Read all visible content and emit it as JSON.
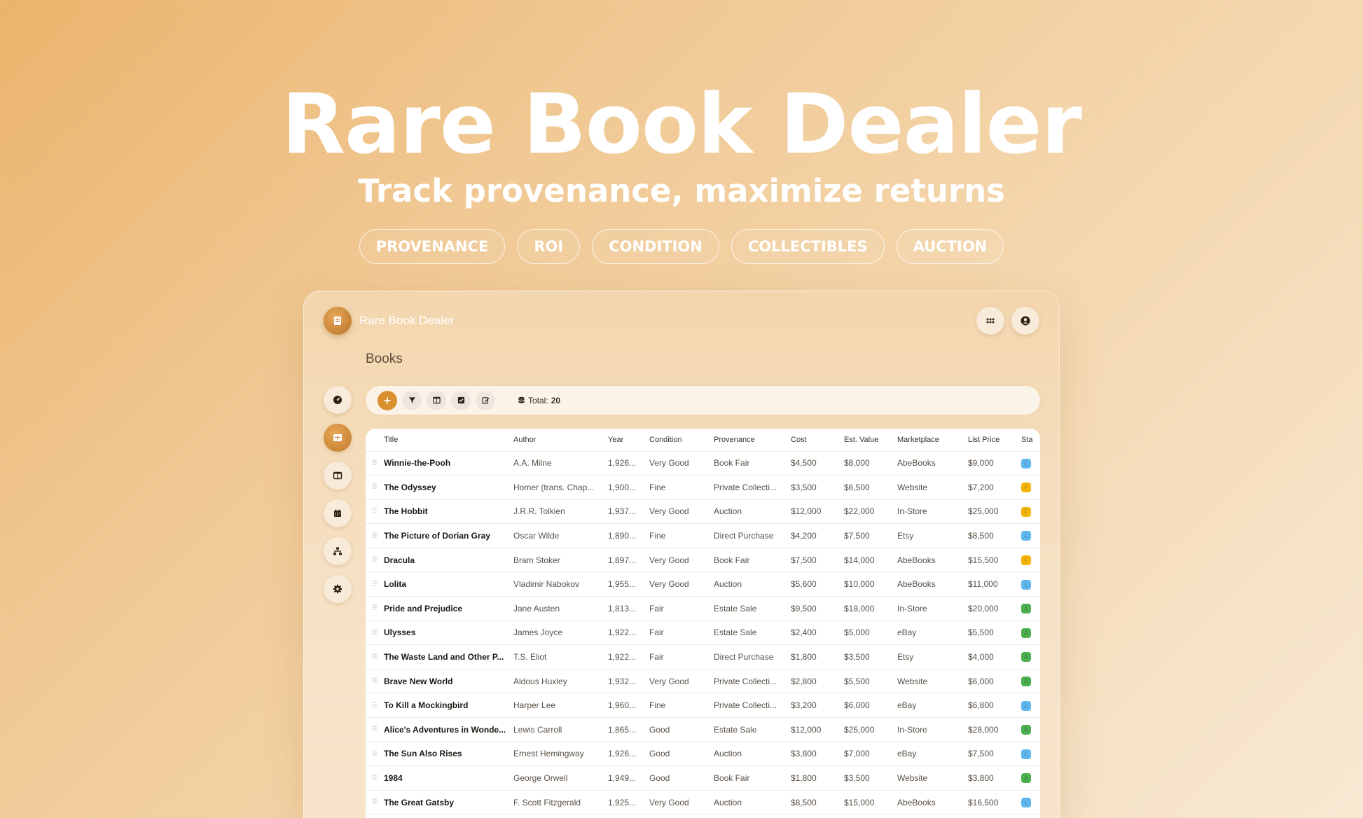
{
  "hero": {
    "title": "Rare Book Dealer",
    "subtitle": "Track provenance, maximize returns",
    "tags": [
      "PROVENANCE",
      "ROI",
      "CONDITION",
      "COLLECTIBLES",
      "AUCTION"
    ]
  },
  "app": {
    "name": "Rare Book Dealer",
    "page_title": "Books",
    "total_label": "Total:",
    "total_value": "20"
  },
  "icons": {
    "logo": "book-icon",
    "top": [
      "grid-icon",
      "user-circle-icon"
    ],
    "sidebar": [
      "dashboard-icon",
      "table-icon",
      "columns-icon",
      "calendar-icon",
      "hierarchy-icon",
      "gear-icon"
    ],
    "toolbar": [
      "plus-icon",
      "filter-icon",
      "columns-icon",
      "checkbox-icon",
      "edit-icon",
      "database-icon"
    ]
  },
  "colors": {
    "accent": "#d9902f",
    "status_blue": "#5eb6ec",
    "status_yellow": "#f4b400",
    "status_green": "#4caf50"
  },
  "table": {
    "columns": [
      "Title",
      "Author",
      "Year",
      "Condition",
      "Provenance",
      "Cost",
      "Est. Value",
      "Marketplace",
      "List Price",
      "Sta"
    ],
    "rows": [
      {
        "title": "Winnie-the-Pooh",
        "author": "A.A. Milne",
        "year": "1,926...",
        "condition": "Very Good",
        "provenance": "Book Fair",
        "cost": "$4,500",
        "value": "$8,000",
        "market": "AbeBooks",
        "price": "$9,000",
        "status": "L",
        "status_color": "#5eb6ec"
      },
      {
        "title": "The Odyssey",
        "author": "Homer (trans. Chap...",
        "year": "1,900...",
        "condition": "Fine",
        "provenance": "Private Collecti...",
        "cost": "$3,500",
        "value": "$6,500",
        "market": "Website",
        "price": "$7,200",
        "status": "F",
        "status_color": "#f4b400"
      },
      {
        "title": "The Hobbit",
        "author": "J.R.R. Tolkien",
        "year": "1,937...",
        "condition": "Very Good",
        "provenance": "Auction",
        "cost": "$12,000",
        "value": "$22,000",
        "market": "In-Store",
        "price": "$25,000",
        "status": "F",
        "status_color": "#f4b400"
      },
      {
        "title": "The Picture of Dorian Gray",
        "author": "Oscar Wilde",
        "year": "1,890...",
        "condition": "Fine",
        "provenance": "Direct Purchase",
        "cost": "$4,200",
        "value": "$7,500",
        "market": "Etsy",
        "price": "$8,500",
        "status": "L",
        "status_color": "#5eb6ec"
      },
      {
        "title": "Dracula",
        "author": "Bram Stoker",
        "year": "1,897...",
        "condition": "Very Good",
        "provenance": "Book Fair",
        "cost": "$7,500",
        "value": "$14,000",
        "market": "AbeBooks",
        "price": "$15,500",
        "status": "F",
        "status_color": "#f4b400"
      },
      {
        "title": "Lolita",
        "author": "Vladimir Nabokov",
        "year": "1,955...",
        "condition": "Very Good",
        "provenance": "Auction",
        "cost": "$5,600",
        "value": "$10,000",
        "market": "AbeBooks",
        "price": "$11,000",
        "status": "L",
        "status_color": "#5eb6ec"
      },
      {
        "title": "Pride and Prejudice",
        "author": "Jane Austen",
        "year": "1,813...",
        "condition": "Fair",
        "provenance": "Estate Sale",
        "cost": "$9,500",
        "value": "$18,000",
        "market": "In-Store",
        "price": "$20,000",
        "status": "A",
        "status_color": "#4caf50"
      },
      {
        "title": "Ulysses",
        "author": "James Joyce",
        "year": "1,922...",
        "condition": "Fair",
        "provenance": "Estate Sale",
        "cost": "$2,400",
        "value": "$5,000",
        "market": "eBay",
        "price": "$5,500",
        "status": "A",
        "status_color": "#4caf50"
      },
      {
        "title": "The Waste Land and Other P...",
        "author": "T.S. Eliot",
        "year": "1,922...",
        "condition": "Fair",
        "provenance": "Direct Purchase",
        "cost": "$1,800",
        "value": "$3,500",
        "market": "Etsy",
        "price": "$4,000",
        "status": "A",
        "status_color": "#4caf50"
      },
      {
        "title": "Brave New World",
        "author": "Aldous Huxley",
        "year": "1,932...",
        "condition": "Very Good",
        "provenance": "Private Collecti...",
        "cost": "$2,800",
        "value": "$5,500",
        "market": "Website",
        "price": "$6,000",
        "status": "A",
        "status_color": "#4caf50"
      },
      {
        "title": "To Kill a Mockingbird",
        "author": "Harper Lee",
        "year": "1,960...",
        "condition": "Fine",
        "provenance": "Private Collecti...",
        "cost": "$3,200",
        "value": "$6,000",
        "market": "eBay",
        "price": "$6,800",
        "status": "L",
        "status_color": "#5eb6ec"
      },
      {
        "title": "Alice's Adventures in Wonde...",
        "author": "Lewis Carroll",
        "year": "1,865...",
        "condition": "Good",
        "provenance": "Estate Sale",
        "cost": "$12,000",
        "value": "$25,000",
        "market": "In-Store",
        "price": "$28,000",
        "status": "A",
        "status_color": "#4caf50"
      },
      {
        "title": "The Sun Also Rises",
        "author": "Ernest Hemingway",
        "year": "1,926...",
        "condition": "Good",
        "provenance": "Auction",
        "cost": "$3,800",
        "value": "$7,000",
        "market": "eBay",
        "price": "$7,500",
        "status": "L",
        "status_color": "#5eb6ec"
      },
      {
        "title": "1984",
        "author": "George Orwell",
        "year": "1,949...",
        "condition": "Good",
        "provenance": "Book Fair",
        "cost": "$1,800",
        "value": "$3,500",
        "market": "Website",
        "price": "$3,800",
        "status": "A",
        "status_color": "#4caf50"
      },
      {
        "title": "The Great Gatsby",
        "author": "F. Scott Fitzgerald",
        "year": "1,925...",
        "condition": "Very Good",
        "provenance": "Auction",
        "cost": "$8,500",
        "value": "$15,000",
        "market": "AbeBooks",
        "price": "$16,500",
        "status": "L",
        "status_color": "#5eb6ec"
      }
    ]
  }
}
